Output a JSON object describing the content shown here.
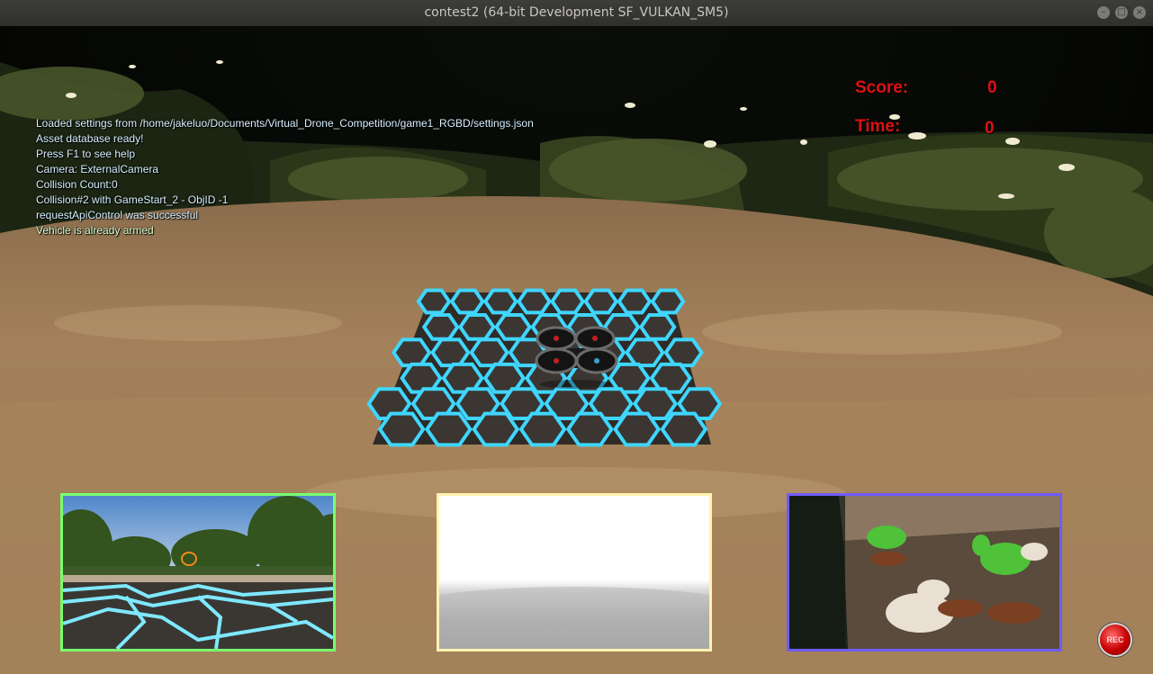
{
  "window": {
    "title": "contest2 (64-bit Development SF_VULKAN_SM5)",
    "controls": {
      "minimize": "–",
      "maximize": "□",
      "close": "×"
    }
  },
  "log": [
    "Loaded settings from /home/jakeluo/Documents/Virtual_Drone_Competition/game1_RGBD/settings.json",
    "Asset database ready!",
    "Press F1 to see help",
    "Camera: ExternalCamera",
    "Collision Count:0",
    "Collision#2 with GameStart_2 - ObjID -1",
    "requestApiControl was successful",
    "Vehicle is already armed"
  ],
  "hud": {
    "score_label": "Score:",
    "score_value": "0",
    "time_label": "Time:",
    "time_value": "0",
    "color": "#e01010"
  },
  "subwindows": [
    {
      "name": "rgb-camera",
      "border_color": "#79ff6e"
    },
    {
      "name": "depth-camera",
      "border_color": "#fff3b0"
    },
    {
      "name": "segmentation-camera",
      "border_color": "#6f5cff"
    }
  ],
  "record_button": {
    "label": "REC",
    "color": "#d40000"
  },
  "scene": {
    "ground_color": "#b08a62",
    "pad_glow_color": "#3fd6ff",
    "pad_tile_color": "#3b3632"
  }
}
